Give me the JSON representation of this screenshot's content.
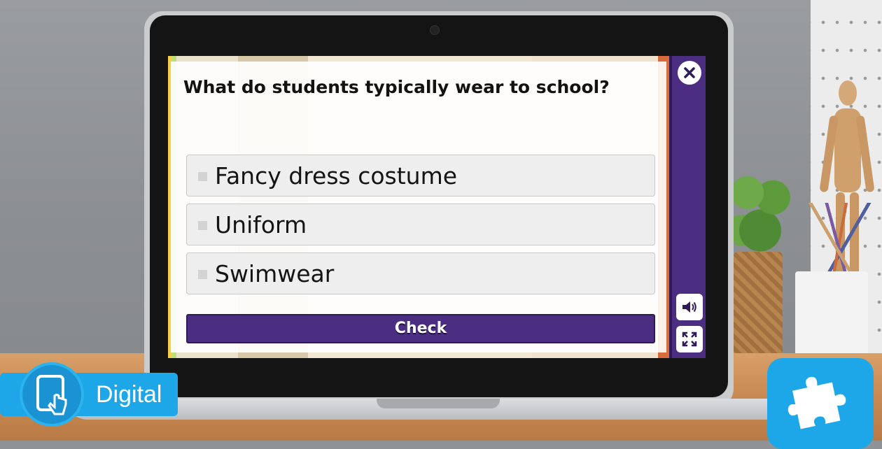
{
  "quiz": {
    "question": "What do students typically wear to school?",
    "options": [
      {
        "label": "Fancy dress costume"
      },
      {
        "label": "Uniform"
      },
      {
        "label": "Swimwear"
      }
    ],
    "check_label": "Check"
  },
  "sidebar": {
    "close_icon": "close-icon",
    "audio_icon": "speaker-icon",
    "fullscreen_icon": "fullscreen-icon"
  },
  "badges": {
    "digital_label": "Digital",
    "digital_icon": "tablet-touch-icon",
    "puzzle_icon": "puzzle-piece-icon"
  },
  "colors": {
    "accent_purple": "#4b2d82",
    "badge_blue": "#1ea7e8"
  }
}
